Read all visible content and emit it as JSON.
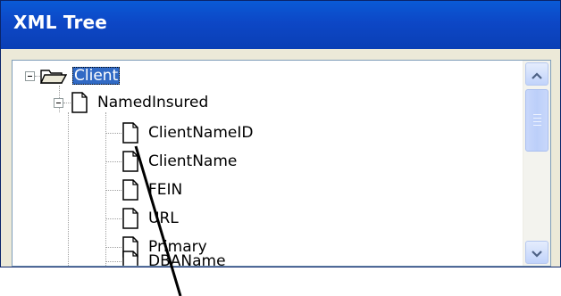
{
  "window": {
    "title": "XML Tree"
  },
  "tree": {
    "root": {
      "label": "Client",
      "icon": "open-folder-icon",
      "selected": true
    },
    "child": {
      "label": "NamedInsured",
      "icon": "document-icon"
    },
    "leaves": [
      {
        "label": "ClientNameID",
        "icon": "document-icon"
      },
      {
        "label": "ClientName",
        "icon": "document-icon"
      },
      {
        "label": "FEIN",
        "icon": "document-icon"
      },
      {
        "label": "URL",
        "icon": "document-icon"
      },
      {
        "label": "Primary",
        "icon": "document-icon"
      },
      {
        "label": "DBAName",
        "icon": "document-icon"
      }
    ]
  },
  "colors": {
    "titlebar": "#0a4ad0",
    "selection": "#316ac5",
    "scrollbar_button": "#c1d3fb"
  },
  "scrollbar": {
    "up_icon": "chevron-up-icon",
    "down_icon": "chevron-down-icon"
  }
}
